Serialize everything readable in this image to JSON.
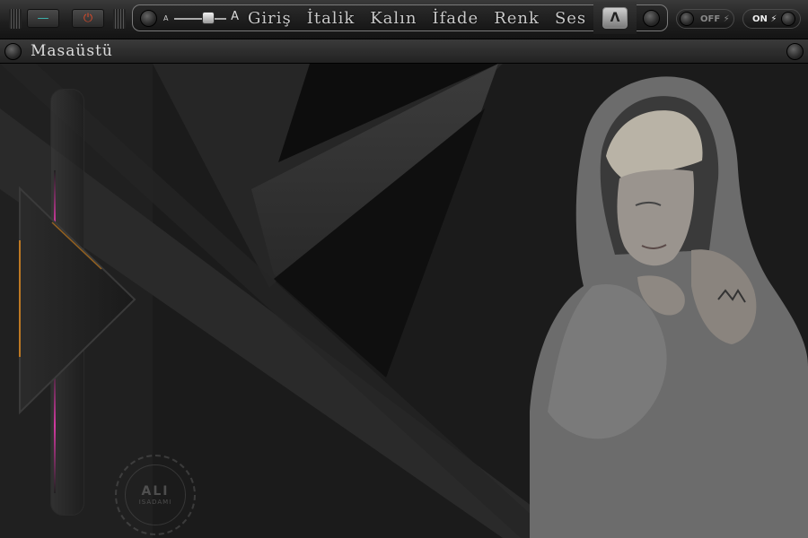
{
  "window_controls": {
    "minimize_glyph": "—",
    "power_glyph": "⏻"
  },
  "font_slider": {
    "small_label": "A",
    "large_label": "A",
    "value_fraction": 0.65
  },
  "menu": {
    "items": [
      "Giriş",
      "İtalik",
      "Kalın",
      "İfade",
      "Renk",
      "Ses"
    ]
  },
  "logo": {
    "glyph": "Λ"
  },
  "switches": {
    "off_label": "OFF",
    "on_label": "ON",
    "bolt_glyph": "⚡"
  },
  "subbar": {
    "title": "Masaüstü"
  },
  "watermark": {
    "line1": "ALI",
    "line2": "ISADAMI"
  },
  "colors": {
    "accent_pink": "#d23aa0",
    "accent_orange": "#e08a1e",
    "power_red": "#d94a2a",
    "minimize_teal": "#3fb6b0"
  },
  "icons": {
    "minimize": "minimize-icon",
    "power": "power-icon",
    "logo": "app-logo-icon",
    "bolt": "bolt-icon",
    "play": "play-icon"
  }
}
